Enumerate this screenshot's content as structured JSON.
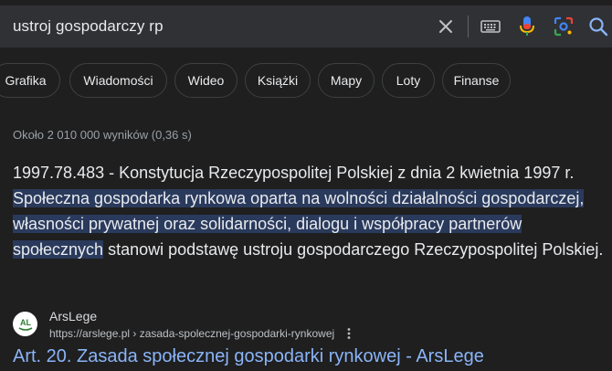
{
  "search": {
    "query": "ustroj gospodarczy rp",
    "icons": [
      "close-icon",
      "keyboard-icon",
      "mic-icon",
      "lens-icon",
      "search-icon"
    ]
  },
  "chips": [
    {
      "label": "Grafika"
    },
    {
      "label": "Wiadomości"
    },
    {
      "label": "Wideo"
    },
    {
      "label": "Książki"
    },
    {
      "label": "Mapy"
    },
    {
      "label": "Loty"
    },
    {
      "label": "Finanse"
    }
  ],
  "result_stats": "Około 2 010 000 wyników (0,36 s)",
  "snippet": {
    "part1": "1997.78.483 - Konstytucja Rzeczypospolitej Polskiej z dnia 2 kwietnia 1997 r. ",
    "highlight": "Społeczna gospodarka rynkowa oparta na wolności działalności gospodarczej, własności prywatnej oraz solidarności, dialogu i współpracy partnerów społecznych",
    "part2": " stanowi podstawę ustroju gospodarczego Rzeczypospolitej Polskiej."
  },
  "source": {
    "name": "ArsLege",
    "url": "https://arslege.pl › zasada-spolecznej-gospodarki-rynkowej",
    "favicon_text": "AL"
  },
  "result_title": "Art. 20. Zasada społecznej gospodarki rynkowej - ArsLege",
  "colors": {
    "background": "#1f1f1f",
    "searchbar": "#303134",
    "link": "#8ab4f8",
    "highlight": "#2a3a5c"
  }
}
